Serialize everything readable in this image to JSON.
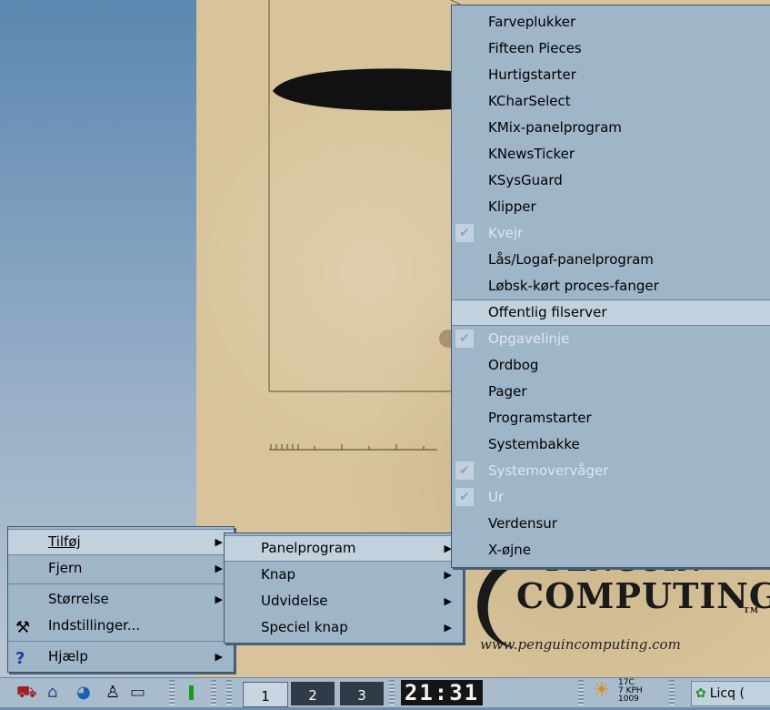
{
  "applets_menu": {
    "items": [
      {
        "label": "Farveplukker",
        "checked": false,
        "disabled": false
      },
      {
        "label": "Fifteen Pieces",
        "checked": false,
        "disabled": false
      },
      {
        "label": "Hurtigstarter",
        "checked": false,
        "disabled": false
      },
      {
        "label": "KCharSelect",
        "checked": false,
        "disabled": false
      },
      {
        "label": "KMix-panelprogram",
        "checked": false,
        "disabled": false
      },
      {
        "label": "KNewsTicker",
        "checked": false,
        "disabled": false
      },
      {
        "label": "KSysGuard",
        "checked": false,
        "disabled": false
      },
      {
        "label": "Klipper",
        "checked": false,
        "disabled": false
      },
      {
        "label": "Kvejr",
        "checked": true,
        "disabled": true
      },
      {
        "label": "Lås/Logaf-panelprogram",
        "checked": false,
        "disabled": false
      },
      {
        "label": "Løbsk-kørt proces-fanger",
        "checked": false,
        "disabled": false
      },
      {
        "label": "Offentlig filserver",
        "checked": false,
        "disabled": false,
        "highlighted": true
      },
      {
        "label": "Opgavelinje",
        "checked": true,
        "disabled": true
      },
      {
        "label": "Ordbog",
        "checked": false,
        "disabled": false
      },
      {
        "label": "Pager",
        "checked": false,
        "disabled": false
      },
      {
        "label": "Programstarter",
        "checked": false,
        "disabled": false
      },
      {
        "label": "Systembakke",
        "checked": false,
        "disabled": false
      },
      {
        "label": "Systemovervåger",
        "checked": true,
        "disabled": true
      },
      {
        "label": "Ur",
        "checked": true,
        "disabled": true
      },
      {
        "label": "Verdensur",
        "checked": false,
        "disabled": false
      },
      {
        "label": "X-øjne",
        "checked": false,
        "disabled": false
      }
    ]
  },
  "add_menu": {
    "items": [
      {
        "label": "Panelprogram",
        "highlighted": true
      },
      {
        "label": "Knap",
        "highlighted": false
      },
      {
        "label": "Udvidelse",
        "highlighted": false
      },
      {
        "label": "Speciel knap",
        "highlighted": false
      }
    ]
  },
  "panel_menu": {
    "tilfoj": "Tilføj",
    "fjern": "Fjern",
    "storrelse": "Størrelse",
    "indstillinger": "Indstillinger...",
    "hjaelp": "Hjælp"
  },
  "taskbar": {
    "pager": [
      "1",
      "2",
      "3"
    ],
    "clock": "21:31",
    "weather": {
      "temp": "17C",
      "wind": "7 KPH",
      "pressure": "1009"
    },
    "licq_label": "Licq ("
  },
  "wallpaper": {
    "logo_line1": "PENGUIN",
    "logo_line2": "COMPUTING",
    "logo_trademark": "TM",
    "logo_url": "www.penguincomputing.com"
  },
  "icons": {
    "check": "check-icon",
    "submenu_arrow": "triangle-right-icon"
  }
}
